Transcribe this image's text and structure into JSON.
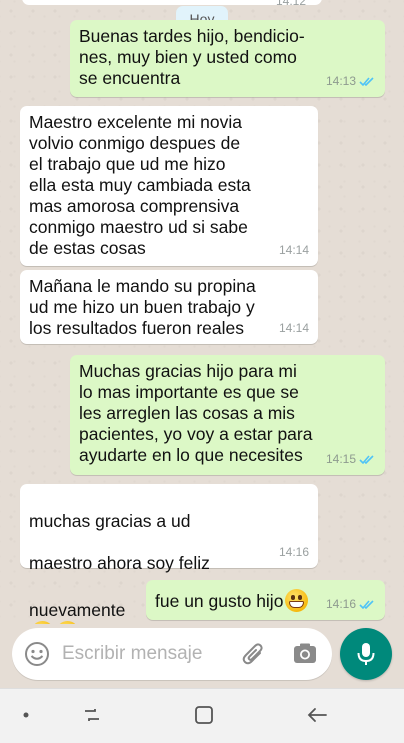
{
  "chat": {
    "partial_top": {
      "time": "14:12"
    },
    "day_label": "Hoy",
    "messages": [
      {
        "dir": "out",
        "text": "Buenas tardes hijo, bendicio-\nnes, muy bien y usted como\nse encuentra",
        "time": "14:13",
        "read": true
      },
      {
        "dir": "in",
        "text": "Maestro excelente mi novia\nvolvio conmigo despues de\nel trabajo que ud me hizo\nella esta muy cambiada esta\nmas amorosa comprensiva\nconmigo maestro ud si sabe\nde estas cosas",
        "time": "14:14"
      },
      {
        "dir": "in",
        "text": "Mañana le mando su propina\nud me hizo un buen trabajo y\nlos resultados fueron reales",
        "time": "14:14"
      },
      {
        "dir": "out",
        "text": "Muchas gracias hijo para mi\nlo mas importante es que se\nles arreglen las cosas a mis\npacientes, yo voy a estar para\nayudarte en lo que necesites",
        "time": "14:15",
        "read": true
      },
      {
        "dir": "in",
        "text_lines": [
          "muchas gracias a ud",
          "maestro ahora soy feliz",
          "nuevamente"
        ],
        "emojis": [
          "heart-eyes-emoji",
          "heart-eyes-emoji"
        ],
        "time": "14:16"
      },
      {
        "dir": "out",
        "text": "fue un gusto hijo",
        "emojis": [
          "grinning-emoji"
        ],
        "time": "14:16",
        "read": true
      }
    ]
  },
  "composer": {
    "placeholder": "Escribir mensaje",
    "icons": [
      "emoji-icon",
      "paperclip-icon",
      "camera-icon",
      "microphone-icon"
    ]
  },
  "navigation": {
    "icons": [
      "dot-icon",
      "recent-apps-icon",
      "home-icon",
      "back-icon"
    ]
  },
  "colors": {
    "outgoing_bubble": "#dcf8c6",
    "incoming_bubble": "#ffffff",
    "wallpaper": "#e5ddd5",
    "accent": "#00897b",
    "read_ticks": "#4fc3f7"
  }
}
